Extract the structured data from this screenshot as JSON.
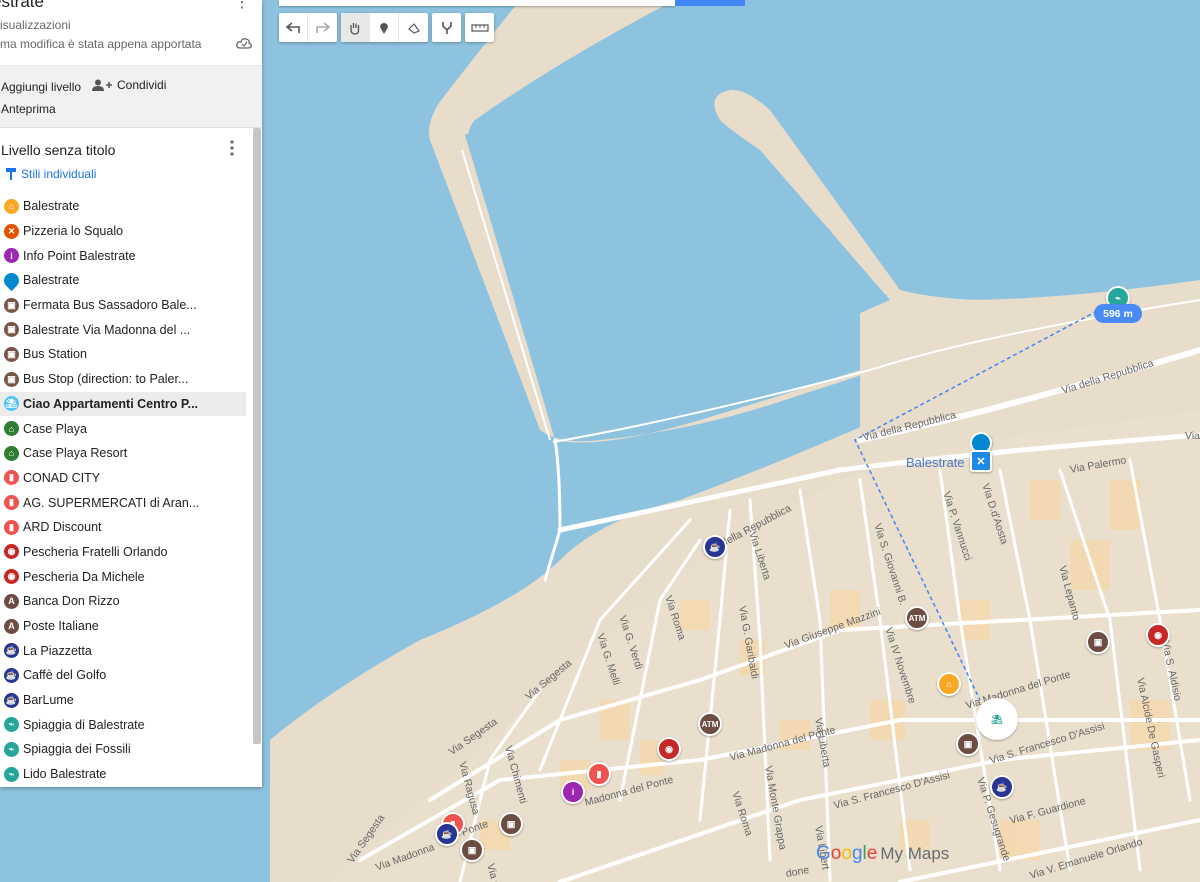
{
  "panel": {
    "title": "estrate",
    "views": "isualizzazioni",
    "saved_status": "ma modifica è stata appena apportata",
    "add_layer": "Aggiungi livello",
    "share": "Condividi",
    "preview": "Anteprima",
    "layer_title": "Livello senza titolo",
    "styles_label": "Stili individuali",
    "items": [
      {
        "label": "Balestrate",
        "icon": "home-icon",
        "color": "#f9a825"
      },
      {
        "label": "Pizzeria lo Squalo",
        "icon": "restaurant-icon",
        "color": "#e65100"
      },
      {
        "label": "Info Point Balestrate",
        "icon": "info-icon",
        "color": "#9c27b0"
      },
      {
        "label": "Balestrate",
        "icon": "pin-icon",
        "color": "#0288d1"
      },
      {
        "label": "Fermata Bus Sassadoro Bale...",
        "icon": "bus-icon",
        "color": "#795548"
      },
      {
        "label": "Balestrate Via Madonna del ...",
        "icon": "bus-icon",
        "color": "#795548"
      },
      {
        "label": "Bus Station",
        "icon": "bus-icon",
        "color": "#795548"
      },
      {
        "label": "Bus Stop (direction: to Paler...",
        "icon": "bus-icon",
        "color": "#795548"
      },
      {
        "label": "Ciao Appartamenti Centro P...",
        "icon": "hotel-logo-icon",
        "color": "#4fc3f7",
        "selected": true
      },
      {
        "label": "Case Playa",
        "icon": "home-icon",
        "color": "#2e7d32"
      },
      {
        "label": "Case Playa Resort",
        "icon": "home-icon",
        "color": "#2e7d32"
      },
      {
        "label": "CONAD CITY",
        "icon": "shopping-icon",
        "color": "#ef5350"
      },
      {
        "label": "AG. SUPERMERCATI di Aran...",
        "icon": "shopping-icon",
        "color": "#ef5350"
      },
      {
        "label": "ARD Discount",
        "icon": "shopping-icon",
        "color": "#ef5350"
      },
      {
        "label": "Pescheria Fratelli Orlando",
        "icon": "fish-icon",
        "color": "#c62828"
      },
      {
        "label": "Pescheria Da Michele",
        "icon": "fish-icon",
        "color": "#c62828"
      },
      {
        "label": "Banca Don Rizzo",
        "icon": "atm-icon",
        "color": "#6d4c41"
      },
      {
        "label": "Poste Italiane",
        "icon": "atm-icon",
        "color": "#6d4c41"
      },
      {
        "label": "La Piazzetta",
        "icon": "cafe-icon",
        "color": "#283593"
      },
      {
        "label": "Caffè del Golfo",
        "icon": "cafe-icon",
        "color": "#283593"
      },
      {
        "label": "BarLume",
        "icon": "cafe-icon",
        "color": "#283593"
      },
      {
        "label": "Spiaggia di Balestrate",
        "icon": "beach-icon",
        "color": "#26a69a"
      },
      {
        "label": "Spiaggia dei Fossili",
        "icon": "beach-icon",
        "color": "#26a69a"
      },
      {
        "label": "Lido Balestrate",
        "icon": "beach-icon",
        "color": "#26a69a"
      }
    ]
  },
  "map": {
    "place_label": "Balestrate",
    "distance": "596 m",
    "brand_google": "Google",
    "brand_suffix": "My Maps",
    "atm_text": "ATM",
    "streets": {
      "s1": "Via della Repubblica",
      "s2": "Via della Repubblica",
      "s3": "della Repubblica",
      "s4": "Via Palermo",
      "s5": "Via Liberta",
      "s6": "Via S. Giovanni B.",
      "s7": "Via P. Vannucci",
      "s8": "Via D.d'Aosta",
      "s9": "Via Lepanto",
      "s10": "Via Roma",
      "s11": "Via G. Garibaldi",
      "s12": "Via Giuseppe Mazzini",
      "s13": "Via IV Novembre",
      "s14": "Via Madonna del Ponte",
      "s15": "Via Segesta",
      "s16": "Via G. Verdi",
      "s17": "Via G. Melli",
      "s18": "Via Segesta",
      "s19": "Via Madonna del Ponte",
      "s20": "Madonna del Ponte",
      "s21": "Via Chimenti",
      "s22": "Via Ragusa",
      "s23": "Via Segesta",
      "s24": "Via Madonna del Ponte",
      "s25": "Via Liberta",
      "s26": "Via Monte Grappa",
      "s27": "Via Roma",
      "s28": "Via S. Francesco D'Assisi",
      "s29": "Via S. Francesco D'Assisi",
      "s30": "Via P. Gesugrande",
      "s31": "Via F. Guardione",
      "s32": "Via V. Emanuele Orlando",
      "s33": "Via Alcide De Gasperi",
      "s34": "Via S. Aldisio",
      "s35": "Via Libert",
      "s36": "Via Madonna",
      "s37": "Ponte",
      "s38": "Via d",
      "s39": "Via",
      "s40": "done"
    }
  },
  "colors": {
    "sea": "#8ec3e0",
    "land": "#e8dccb",
    "building": "#f9d9a8",
    "road": "#ffffff",
    "route": "#4285f4"
  }
}
